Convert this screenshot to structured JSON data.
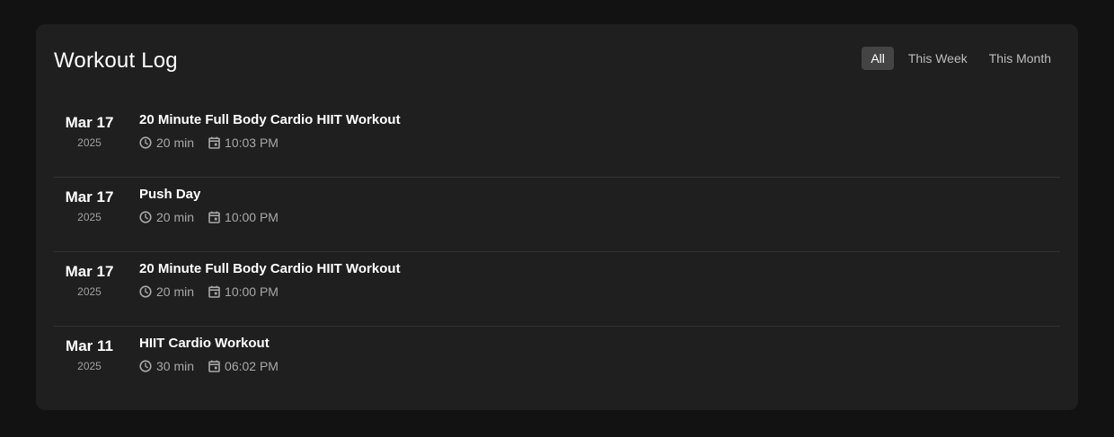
{
  "header": {
    "title": "Workout Log",
    "filters": [
      {
        "label": "All",
        "active": true
      },
      {
        "label": "This Week",
        "active": false
      },
      {
        "label": "This Month",
        "active": false
      }
    ]
  },
  "workouts": [
    {
      "date": "Mar 17",
      "year": "2025",
      "title": "20 Minute Full Body Cardio HIIT Workout",
      "duration": "20 min",
      "time": "10:03 PM"
    },
    {
      "date": "Mar 17",
      "year": "2025",
      "title": "Push Day",
      "duration": "20 min",
      "time": "10:00 PM"
    },
    {
      "date": "Mar 17",
      "year": "2025",
      "title": "20 Minute Full Body Cardio HIIT Workout",
      "duration": "20 min",
      "time": "10:00 PM"
    },
    {
      "date": "Mar 11",
      "year": "2025",
      "title": "HIIT Cardio Workout",
      "duration": "30 min",
      "time": "06:02 PM"
    }
  ],
  "icons": {
    "duration": "clock-icon",
    "time": "calendar-icon"
  },
  "colors": {
    "page_background": "#121212",
    "card_background": "#1f1f1f",
    "active_filter_background": "#444444",
    "muted_text": "#a8a8a8"
  }
}
